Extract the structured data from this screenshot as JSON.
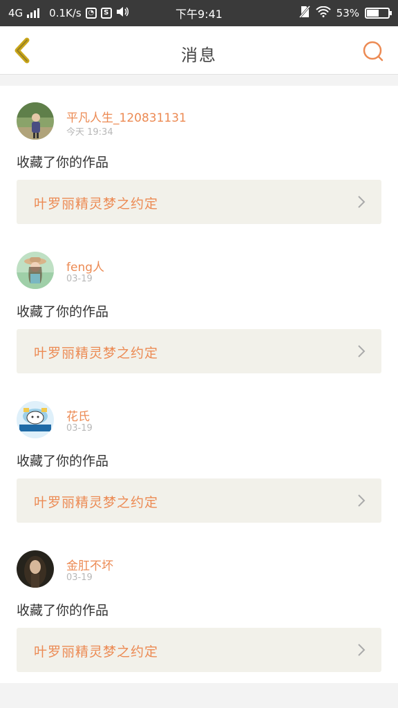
{
  "status_bar": {
    "network": "4G",
    "speed": "0.1K/s",
    "time": "下午9:41",
    "battery": "53%",
    "battery_level": 0.53
  },
  "nav": {
    "title": "消息",
    "back_icon": "chevron-left-icon",
    "search_icon": "search-icon"
  },
  "colors": {
    "accent": "#ec8a53",
    "back_icon": "#c9a61a",
    "card_link_bg": "#f2f1ea"
  },
  "messages": [
    {
      "user": "平凡人生_120831131",
      "time": "今天 19:34",
      "action": "收藏了你的作品",
      "work_title": "叶罗丽精灵梦之约定"
    },
    {
      "user": "feng人",
      "time": "03-19",
      "action": "收藏了你的作品",
      "work_title": "叶罗丽精灵梦之约定"
    },
    {
      "user": "花氏",
      "time": "03-19",
      "action": "收藏了你的作品",
      "work_title": "叶罗丽精灵梦之约定"
    },
    {
      "user": "金肛不坏",
      "time": "03-19",
      "action": "收藏了你的作品",
      "work_title": "叶罗丽精灵梦之约定"
    }
  ]
}
